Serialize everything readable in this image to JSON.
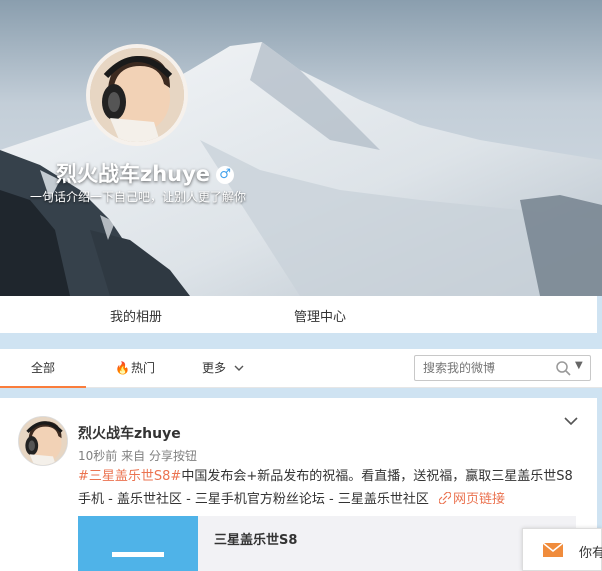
{
  "profile": {
    "name": "烈火战车zhuye",
    "gender_symbol": "♂",
    "intro": "一句话介绍一下自己吧，让别人更了解你"
  },
  "profile_nav": {
    "items": [
      "我的相册",
      "管理中心"
    ]
  },
  "feed_tabs": {
    "items": [
      "全部",
      "热门",
      "更多"
    ],
    "active": "全部",
    "search_placeholder": "搜索我的微博"
  },
  "post": {
    "author": "烈火战车zhuye",
    "time": "10秒前",
    "source_prefix": "来自",
    "source": "分享按钮",
    "hashtag": "#三星盖乐世S8#",
    "text": "中国发布会+新品发布的祝福。看直播，送祝福，赢取三星盖乐世S8手机 - 盖乐世社区 - 三星手机官方粉丝论坛 - 三星盖乐世社区",
    "link_label": "网页链接",
    "share_title": "三星盖乐世S8"
  },
  "message_float": {
    "label": "你有"
  },
  "colors": {
    "accent": "#eb7350",
    "tab_active": "#fa7d3c",
    "share_thumb": "#4fb3e8"
  }
}
